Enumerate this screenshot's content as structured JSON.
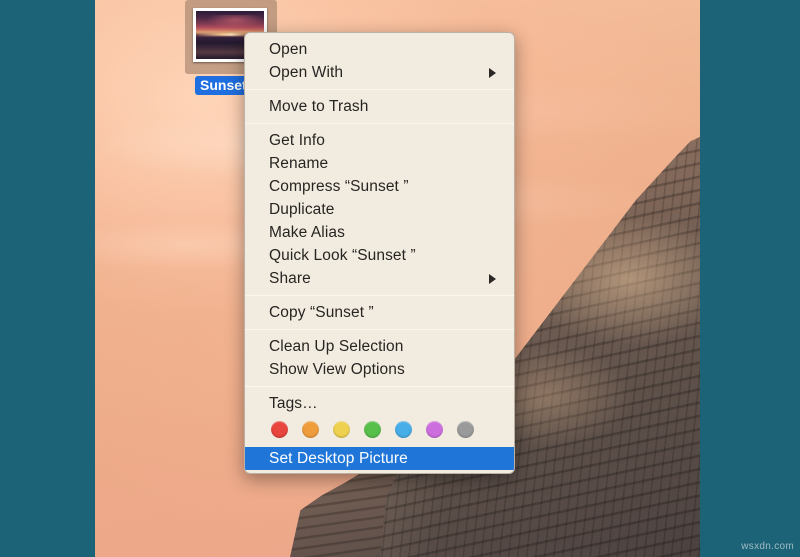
{
  "desktop": {
    "wallpaper_name": "OS X Yosemite El Capitan sunset",
    "background_color": "#1d6377",
    "file_icon": {
      "name": "sunset-image-file",
      "label": "Sunset",
      "selected": true,
      "thumbnail_alt": "Sunset over water photo"
    }
  },
  "context_menu": {
    "groups": [
      {
        "items": [
          {
            "label": "Open",
            "submenu": false,
            "highlighted": false
          },
          {
            "label": "Open With",
            "submenu": true,
            "highlighted": false
          }
        ]
      },
      {
        "items": [
          {
            "label": "Move to Trash",
            "submenu": false,
            "highlighted": false
          }
        ]
      },
      {
        "items": [
          {
            "label": "Get Info",
            "submenu": false,
            "highlighted": false
          },
          {
            "label": "Rename",
            "submenu": false,
            "highlighted": false
          },
          {
            "label": "Compress “Sunset ”",
            "submenu": false,
            "highlighted": false
          },
          {
            "label": "Duplicate",
            "submenu": false,
            "highlighted": false
          },
          {
            "label": "Make Alias",
            "submenu": false,
            "highlighted": false
          },
          {
            "label": "Quick Look “Sunset ”",
            "submenu": false,
            "highlighted": false
          },
          {
            "label": "Share",
            "submenu": true,
            "highlighted": false
          }
        ]
      },
      {
        "items": [
          {
            "label": "Copy “Sunset ”",
            "submenu": false,
            "highlighted": false
          }
        ]
      },
      {
        "items": [
          {
            "label": "Clean Up Selection",
            "submenu": false,
            "highlighted": false
          },
          {
            "label": "Show View Options",
            "submenu": false,
            "highlighted": false
          }
        ]
      },
      {
        "items": [
          {
            "label": "Tags…",
            "submenu": false,
            "highlighted": false
          }
        ]
      }
    ],
    "tag_colors": [
      {
        "name": "red",
        "hex": "#e8453c"
      },
      {
        "name": "orange",
        "hex": "#ef9c3c"
      },
      {
        "name": "yellow",
        "hex": "#eed14e"
      },
      {
        "name": "green",
        "hex": "#56c martin"
      },
      {
        "name": "blue",
        "hex": "#47aee8"
      },
      {
        "name": "purple",
        "hex": "#cd6ede"
      },
      {
        "name": "gray",
        "hex": "#9a9a9a"
      }
    ],
    "bottom_item": {
      "label": "Set Desktop Picture",
      "highlighted": true,
      "highlight_color": "#2076d8"
    }
  },
  "watermark": {
    "text": "wsxdn.com"
  }
}
